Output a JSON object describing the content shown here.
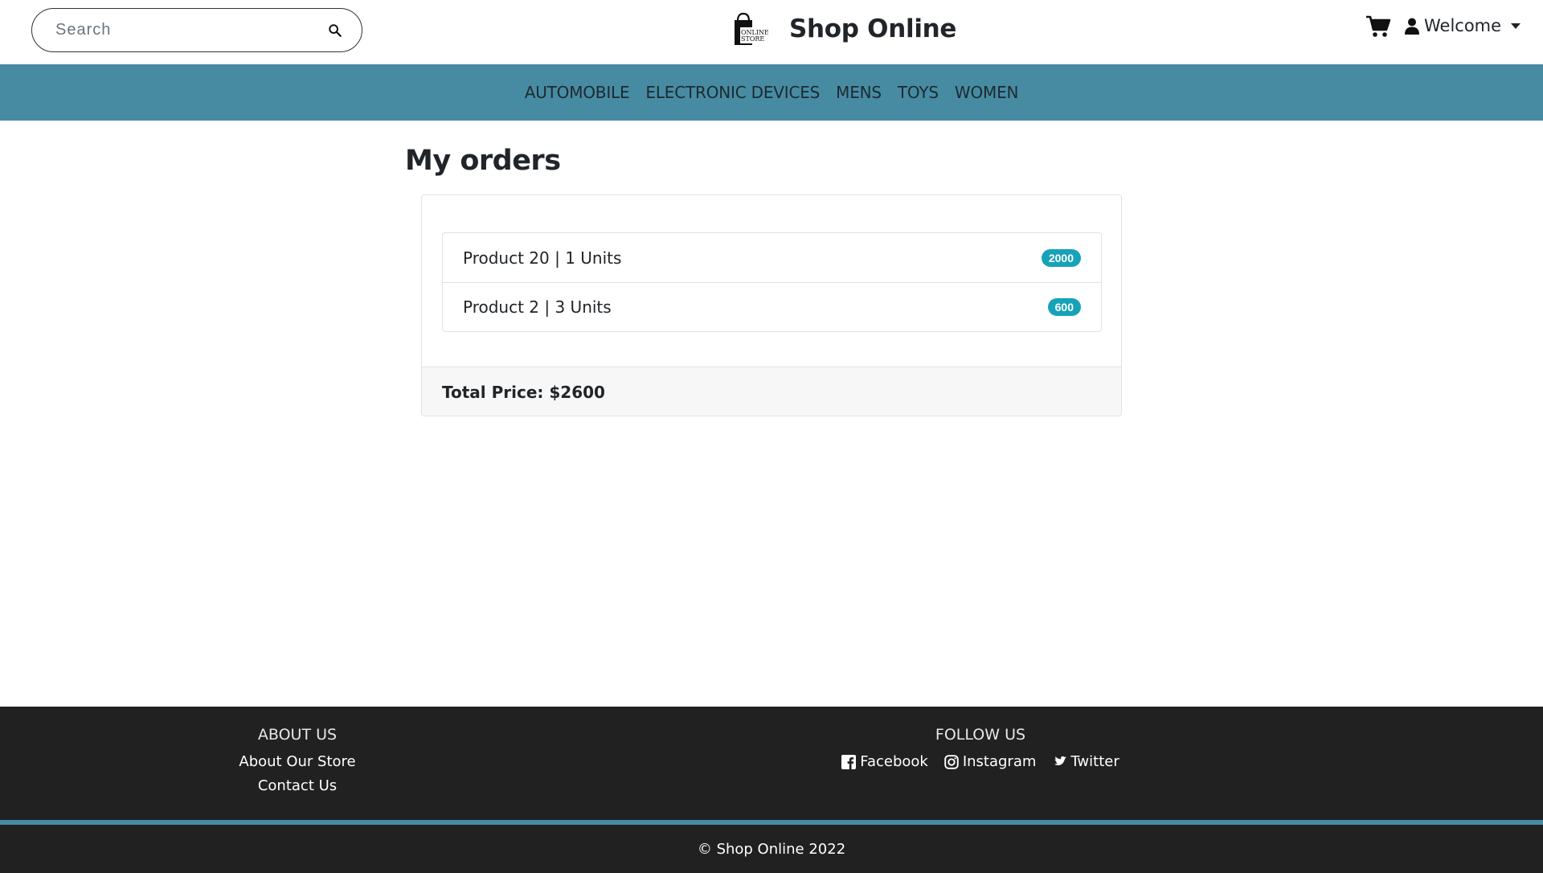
{
  "header": {
    "search": {
      "placeholder": "Search",
      "value": ""
    },
    "brand": {
      "name": "Shop Online",
      "logo_text_1": "ONLINE",
      "logo_text_2": "STORE"
    },
    "user_menu": {
      "label": "Welcome"
    }
  },
  "nav": {
    "items": [
      {
        "label": "AUTOMOBILE"
      },
      {
        "label": "ELECTRONIC DEVICES"
      },
      {
        "label": "MENS"
      },
      {
        "label": "TOYS"
      },
      {
        "label": "WOMEN"
      }
    ]
  },
  "main": {
    "title": "My orders",
    "orders": [
      {
        "label": "Product 20 | 1 Units",
        "badge": "2000"
      },
      {
        "label": "Product 2 | 3 Units",
        "badge": "600"
      }
    ],
    "total": "Total Price: $2600"
  },
  "footer": {
    "about": {
      "heading": "ABOUT US",
      "links": [
        {
          "label": "About Our Store"
        },
        {
          "label": "Contact Us"
        }
      ]
    },
    "follow": {
      "heading": "FOLLOW US",
      "links": [
        {
          "label": "Facebook",
          "icon": "facebook-icon"
        },
        {
          "label": "Instagram",
          "icon": "instagram-icon"
        },
        {
          "label": "Twitter",
          "icon": "twitter-icon"
        }
      ]
    },
    "copyright": "© Shop Online 2022"
  },
  "colors": {
    "navbar": "#478ba3",
    "badge": "#17a2b8",
    "footer": "#212121"
  }
}
